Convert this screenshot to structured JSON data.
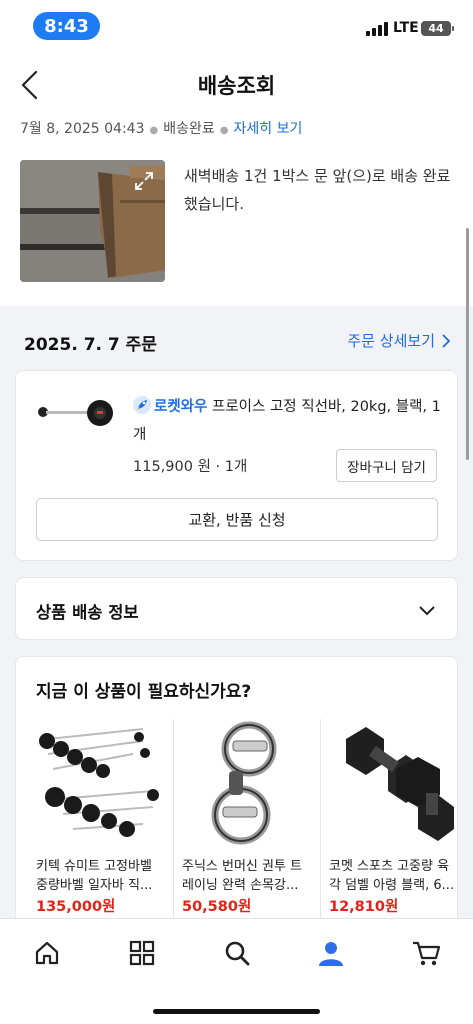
{
  "status_bar": {
    "time": "8:43",
    "network": "LTE",
    "battery": "44"
  },
  "header": {
    "title": "배송조회",
    "date": "7월 8, 2025 04:43",
    "status": "배송완료",
    "detail_link": "자세히 보기",
    "message": "새벽배송 1건 1박스 문 앞(으)로 배송 완료했습니다."
  },
  "order": {
    "date": "2025. 7. 7 주문",
    "detail_link": "주문 상세보기",
    "item": {
      "badge": "로켓와우",
      "title": "프로이스 고정 직선바, 20kg, 블랙, 1개",
      "price": "115,900 원 · 1개",
      "cart_button": "장바구니 담기",
      "return_button": "교환, 반품 신청"
    }
  },
  "shipping_info": {
    "title": "상품 배송 정보"
  },
  "recommendations": {
    "title": "지금 이 상품이 필요하신가요?",
    "items": [
      {
        "name": "키텍 슈미트 고정바벨 중량바벨 일자바 직...",
        "price": "135,000원"
      },
      {
        "name": "주닉스 번머신 권투 트레이닝 완력 손목강...",
        "price": "50,580원"
      },
      {
        "name": "코멧 스포츠 고중량 육각 덤벨 아령 블랙, 6...",
        "price": "12,810원"
      }
    ]
  },
  "tabbar": {
    "tabs": [
      "home-icon",
      "category-icon",
      "search-icon",
      "my-icon",
      "cart-icon"
    ],
    "active_color": "#2e6fe8"
  }
}
